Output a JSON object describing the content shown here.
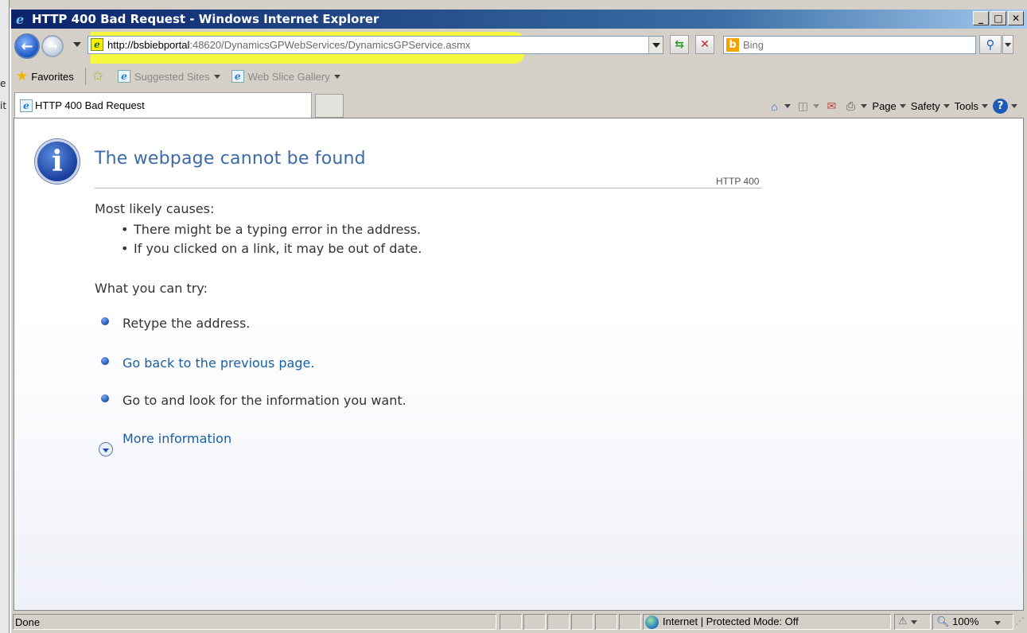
{
  "window": {
    "title": "HTTP 400 Bad Request - Windows Internet Explorer",
    "minimize": "_",
    "maximize": "□",
    "close": "✕"
  },
  "left_edge": {
    "items": [
      "e",
      "it"
    ]
  },
  "nav": {
    "url_host": "http://bsbiebportal",
    "url_rest": ":48620/DynamicsGPWebServices/DynamicsGPService.asmx",
    "refresh_glyph": "⇆",
    "stop_glyph": "✕",
    "search_placeholder": "Bing",
    "search_go_glyph": "⚲"
  },
  "favorites_bar": {
    "favorites": "Favorites",
    "suggested_sites": "Suggested Sites",
    "web_slice_gallery": "Web Slice Gallery"
  },
  "tab": {
    "title": "HTTP 400 Bad Request"
  },
  "command_bar": {
    "page": "Page",
    "safety": "Safety",
    "tools": "Tools",
    "help": "?"
  },
  "page": {
    "heading": "The webpage cannot be found",
    "code": "HTTP 400",
    "causes_title": "Most likely causes:",
    "causes": [
      "There might be a typing error in the address.",
      "If you clicked on a link, it may be out of date."
    ],
    "try_title": "What you can try:",
    "try_items": [
      "Retype the address.",
      "Go back to the previous page.",
      "Go to  and look for the information you want."
    ],
    "more_info": "More information"
  },
  "status_bar": {
    "text": "Done",
    "zone": "Internet | Protected Mode: Off",
    "zoom": "100%"
  },
  "colors": {
    "highlight": "#f7f93a",
    "link": "#1a5fa4",
    "heading": "#3c6aa8"
  }
}
